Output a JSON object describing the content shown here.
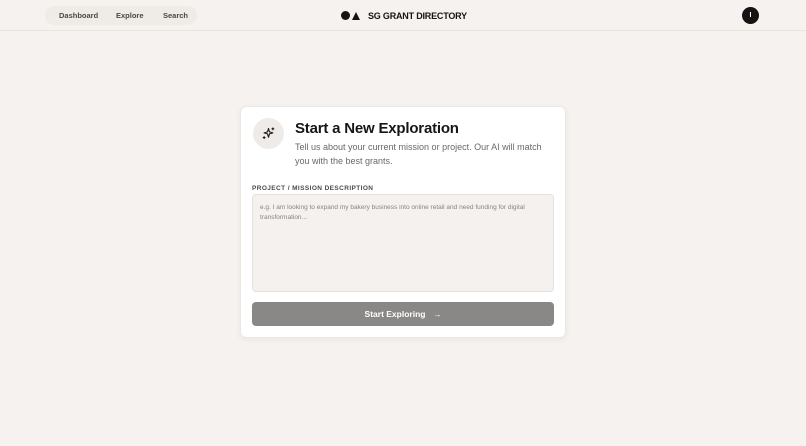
{
  "nav": {
    "items": [
      {
        "label": "Dashboard"
      },
      {
        "label": "Explore"
      },
      {
        "label": "Search"
      }
    ]
  },
  "brand": {
    "name": "SG GRANT DIRECTORY",
    "icon": "circle-triangle-logo"
  },
  "user": {
    "avatar_initial": "I"
  },
  "card": {
    "icon": "sparkles-icon",
    "title": "Start a New Exploration",
    "subtitle": "Tell us about your current mission or project. Our AI will match you with the best grants.",
    "field_label": "PROJECT / MISSION DESCRIPTION",
    "textarea_placeholder": "e.g. I am looking to expand my bakery business into online retail and need funding for digital transformation...",
    "button_label": "Start Exploring",
    "button_icon": "arrow-right-icon"
  },
  "colors": {
    "background": "#f6f2ef",
    "button": "#8a8887",
    "text": "#171515"
  }
}
